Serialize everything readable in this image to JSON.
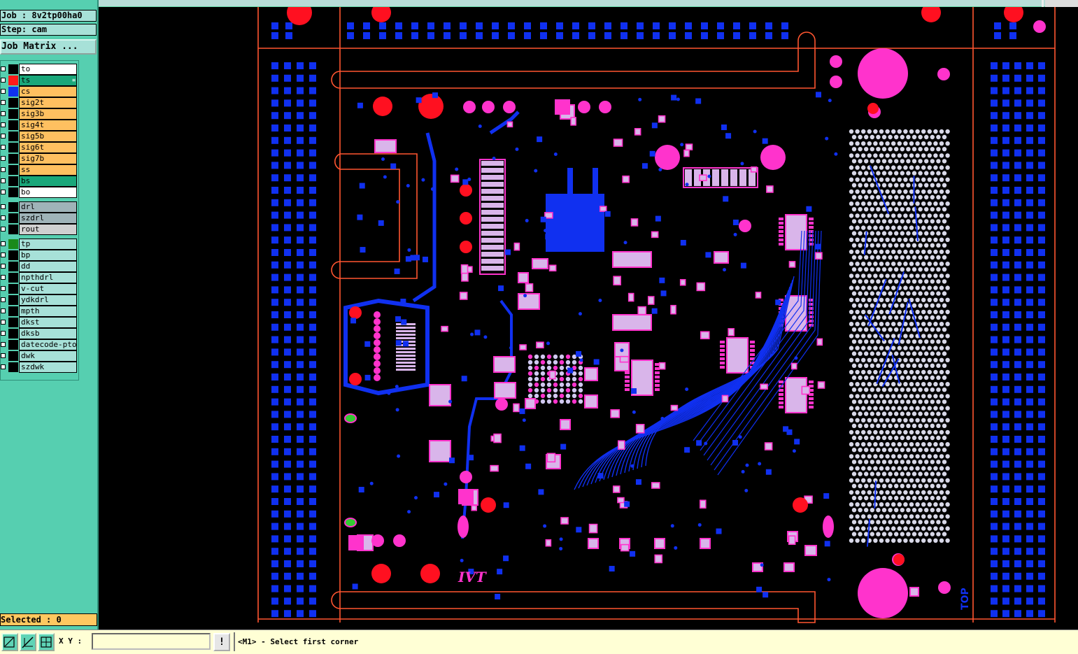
{
  "job": {
    "job_text": "Job : 8v2tp00ha0",
    "step_text": "Step: cam",
    "matrix_button": "Job Matrix ..."
  },
  "layers": [
    {
      "name": "to",
      "swatch": "#000000",
      "bg": "#ffffff",
      "mark": ""
    },
    {
      "name": "ts",
      "swatch": "#ff1a1a",
      "bg": "#1aa77a",
      "mark": "≡"
    },
    {
      "name": "cs",
      "swatch": "#1030f0",
      "bg": "#ffc060",
      "mark": ""
    },
    {
      "name": "sig2t",
      "swatch": "#000000",
      "bg": "#ffc060",
      "mark": ""
    },
    {
      "name": "sig3b",
      "swatch": "#000000",
      "bg": "#ffc060",
      "mark": ""
    },
    {
      "name": "sig4t",
      "swatch": "#000000",
      "bg": "#ffc060",
      "mark": ""
    },
    {
      "name": "sig5b",
      "swatch": "#000000",
      "bg": "#ffc060",
      "mark": ""
    },
    {
      "name": "sig6t",
      "swatch": "#000000",
      "bg": "#ffc060",
      "mark": ""
    },
    {
      "name": "sig7b",
      "swatch": "#000000",
      "bg": "#ffc060",
      "mark": ""
    },
    {
      "name": "ss",
      "swatch": "#000000",
      "bg": "#ffc060",
      "mark": ""
    },
    {
      "name": "bs",
      "swatch": "#000000",
      "bg": "#1aa77a",
      "mark": ""
    },
    {
      "name": "bo",
      "swatch": "#000000",
      "bg": "#ffffff",
      "mark": ""
    }
  ],
  "drill_layers": [
    {
      "name": "drl",
      "swatch": "#000000",
      "bg": "#9fb3b8",
      "mark": ""
    },
    {
      "name": "szdrl",
      "swatch": "#000000",
      "bg": "#9fb3b8",
      "mark": ""
    },
    {
      "name": "rout",
      "swatch": "#000000",
      "bg": "#d0d0d0",
      "mark": ""
    }
  ],
  "doc_layers": [
    {
      "name": "tp",
      "swatch": "#1a8a1a",
      "bg": "#a7e1d8",
      "mark": ""
    },
    {
      "name": "bp",
      "swatch": "#000000",
      "bg": "#a7e1d8",
      "mark": ""
    },
    {
      "name": "dd",
      "swatch": "#000000",
      "bg": "#a7e1d8",
      "mark": ""
    },
    {
      "name": "npthdrl",
      "swatch": "#000000",
      "bg": "#a7e1d8",
      "mark": ""
    },
    {
      "name": "v-cut",
      "swatch": "#000000",
      "bg": "#a7e1d8",
      "mark": ""
    },
    {
      "name": "ydkdrl",
      "swatch": "#000000",
      "bg": "#a7e1d8",
      "mark": ""
    },
    {
      "name": "mpth",
      "swatch": "#000000",
      "bg": "#a7e1d8",
      "mark": ""
    },
    {
      "name": "dkst",
      "swatch": "#000000",
      "bg": "#a7e1d8",
      "mark": ""
    },
    {
      "name": "dksb",
      "swatch": "#000000",
      "bg": "#a7e1d8",
      "mark": ""
    },
    {
      "name": "datecode-pto",
      "swatch": "#000000",
      "bg": "#a7e1d8",
      "mark": ""
    },
    {
      "name": "dwk",
      "swatch": "#000000",
      "bg": "#a7e1d8",
      "mark": ""
    },
    {
      "name": "szdwk",
      "swatch": "#000000",
      "bg": "#a7e1d8",
      "mark": ""
    }
  ],
  "status": {
    "selected_text": "Selected : 0",
    "xy_label": "X Y :",
    "xy_value": "",
    "alert_symbol": "!",
    "prompt_text": "<M1> - Select first corner"
  },
  "board": {
    "silk_logo": "IVT",
    "side_label": "TOP"
  },
  "colors": {
    "pad_pink": "#ff33cc",
    "pad_red": "#ff1020",
    "copper_blue": "#1030f0",
    "outline": "#ff5530",
    "light_pad": "#d9b5ea"
  },
  "icons": [
    "zoom-area-icon",
    "zoom-cursor-icon",
    "grid-icon"
  ]
}
